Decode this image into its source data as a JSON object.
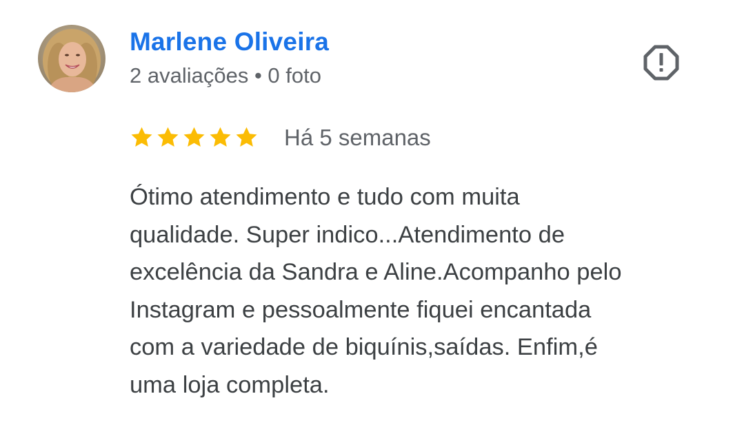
{
  "review": {
    "reviewer": {
      "name": "Marlene Oliveira",
      "meta": "2 avaliações • 0 foto",
      "avatar": "profile-photo"
    },
    "rating": 5,
    "rating_max": 5,
    "date": "Há 5 semanas",
    "text": "Ótimo atendimento e tudo com muita\nqualidade. Super indico...Atendimento de\nexcelência da Sandra e Aline.Acompanho pelo\nInstagram e pessoalmente fiquei encantada\ncom a variedade de biquínis,saídas. Enfim,é\numa loja completa.",
    "flag_icon": "report-octagon-icon"
  },
  "colors": {
    "name": "#1a73e8",
    "meta": "#5f6368",
    "text": "#3c4043",
    "star": "#fbbc04",
    "flag": "#5f6368"
  }
}
